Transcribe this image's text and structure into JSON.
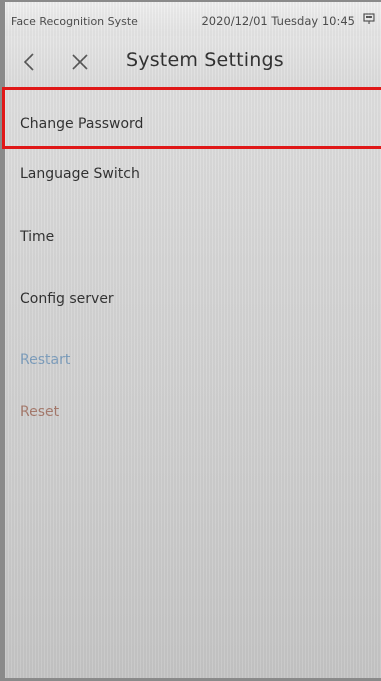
{
  "status_bar": {
    "app_name": "Face Recognition Syste",
    "datetime": "2020/12/01 Tuesday 10:45",
    "icon": "card-reader-icon"
  },
  "nav": {
    "back_icon": "chevron-left-icon",
    "close_icon": "close-icon",
    "title": "System Settings"
  },
  "menu": {
    "items": [
      {
        "label": "Change Password",
        "highlighted": true
      },
      {
        "label": "Language Switch"
      },
      {
        "label": "Time"
      },
      {
        "label": "Config server"
      },
      {
        "label": "Restart",
        "color": "#7d9ebd"
      },
      {
        "label": "Reset",
        "color": "#a67a6c"
      }
    ]
  },
  "colors": {
    "highlight_border": "#e01818",
    "background": "#d8d8d8",
    "text": "#303030"
  }
}
